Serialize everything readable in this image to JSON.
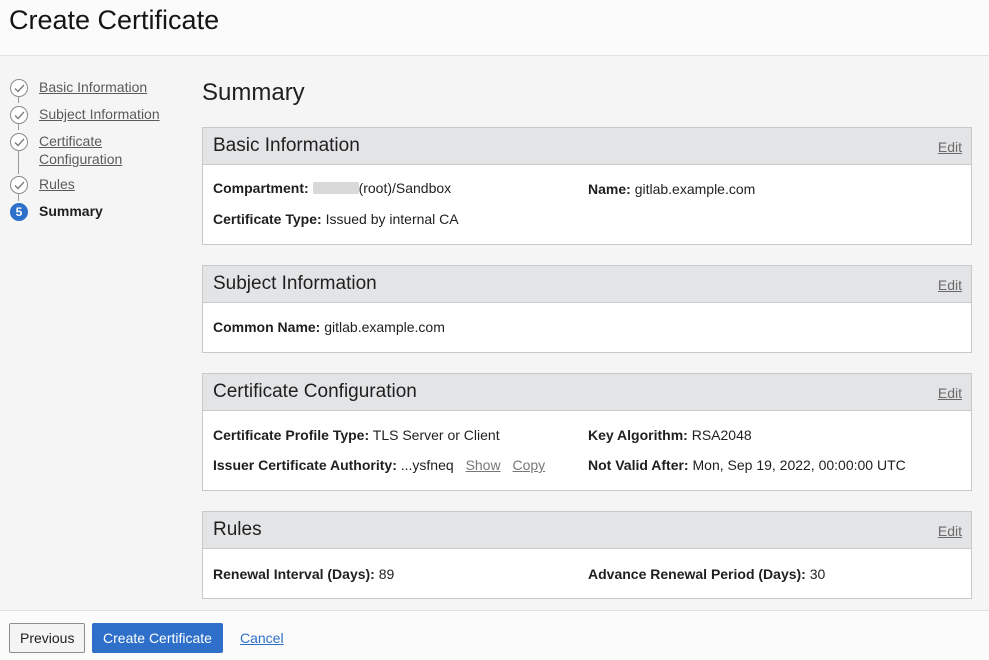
{
  "header": {
    "title": "Create Certificate"
  },
  "steps": [
    {
      "label": "Basic Information",
      "status": "complete"
    },
    {
      "label": "Subject Information",
      "status": "complete"
    },
    {
      "label": "Certificate Configuration",
      "status": "complete"
    },
    {
      "label": "Rules",
      "status": "complete"
    },
    {
      "label": "Summary",
      "status": "current",
      "number": "5"
    }
  ],
  "main": {
    "title": "Summary"
  },
  "panels": {
    "basic": {
      "title": "Basic Information",
      "edit": "Edit",
      "compartment_label": "Compartment:",
      "compartment_value": "(root)/Sandbox",
      "name_label": "Name:",
      "name_value": "gitlab.example.com",
      "type_label": "Certificate Type:",
      "type_value": "Issued by internal CA"
    },
    "subject": {
      "title": "Subject Information",
      "edit": "Edit",
      "cn_label": "Common Name:",
      "cn_value": "gitlab.example.com"
    },
    "config": {
      "title": "Certificate Configuration",
      "edit": "Edit",
      "profile_label": "Certificate Profile Type:",
      "profile_value": "TLS Server or Client",
      "key_label": "Key Algorithm:",
      "key_value": "RSA2048",
      "ca_label": "Issuer Certificate Authority:",
      "ca_value": "...ysfneq",
      "ca_show": "Show",
      "ca_copy": "Copy",
      "valid_label": "Not Valid After:",
      "valid_value": "Mon, Sep 19, 2022, 00:00:00 UTC"
    },
    "rules": {
      "title": "Rules",
      "edit": "Edit",
      "renewal_label": "Renewal Interval (Days):",
      "renewal_value": "89",
      "advance_label": "Advance Renewal Period (Days):",
      "advance_value": "30"
    }
  },
  "footer": {
    "previous": "Previous",
    "create": "Create Certificate",
    "cancel": "Cancel"
  },
  "colors": {
    "accent": "#2d6fc9",
    "panel_header": "#e3e4e6"
  }
}
